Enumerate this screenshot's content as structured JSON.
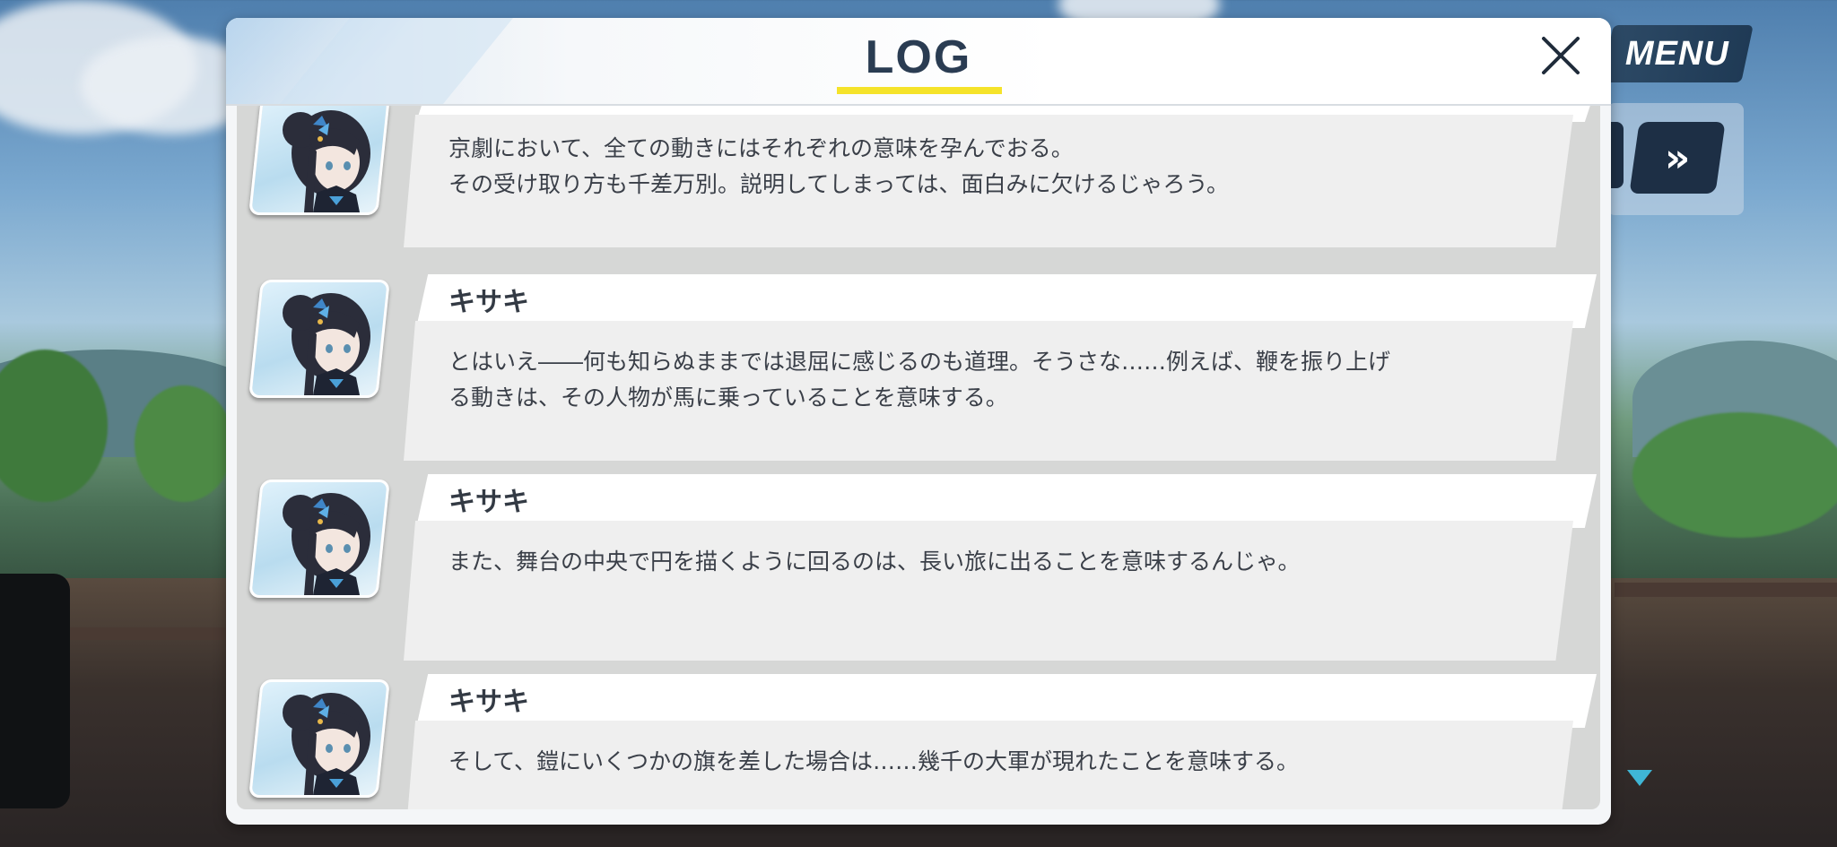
{
  "hud": {
    "menu_label": "MENU",
    "fast_forward_label": "»"
  },
  "log": {
    "title": "LOG",
    "close_label": "✕",
    "entries": [
      {
        "speaker": "",
        "lines": [
          "京劇において、全ての動きにはそれぞれの意味を孕んでおる。",
          "その受け取り方も千差万別。説明してしまっては、面白みに欠けるじゃろう。"
        ]
      },
      {
        "speaker": "キサキ",
        "lines": [
          "とはいえ――何も知らぬままでは退屈に感じるのも道理。そうさな……例えば、鞭を振り上げ",
          "る動きは、その人物が馬に乗っていることを意味する。"
        ]
      },
      {
        "speaker": "キサキ",
        "lines": [
          "また、舞台の中央で円を描くように回るのは、長い旅に出ることを意味するんじゃ。"
        ]
      },
      {
        "speaker": "キサキ",
        "lines": [
          "そして、鎧にいくつかの旗を差した場合は……幾千の大軍が現れたことを意味する。"
        ]
      }
    ]
  },
  "colors": {
    "title_text": "#2a3c52",
    "title_underline": "#f5e32a",
    "menu_bg": "#1f3a55",
    "scroll_arrow": "#3fb6d6"
  }
}
